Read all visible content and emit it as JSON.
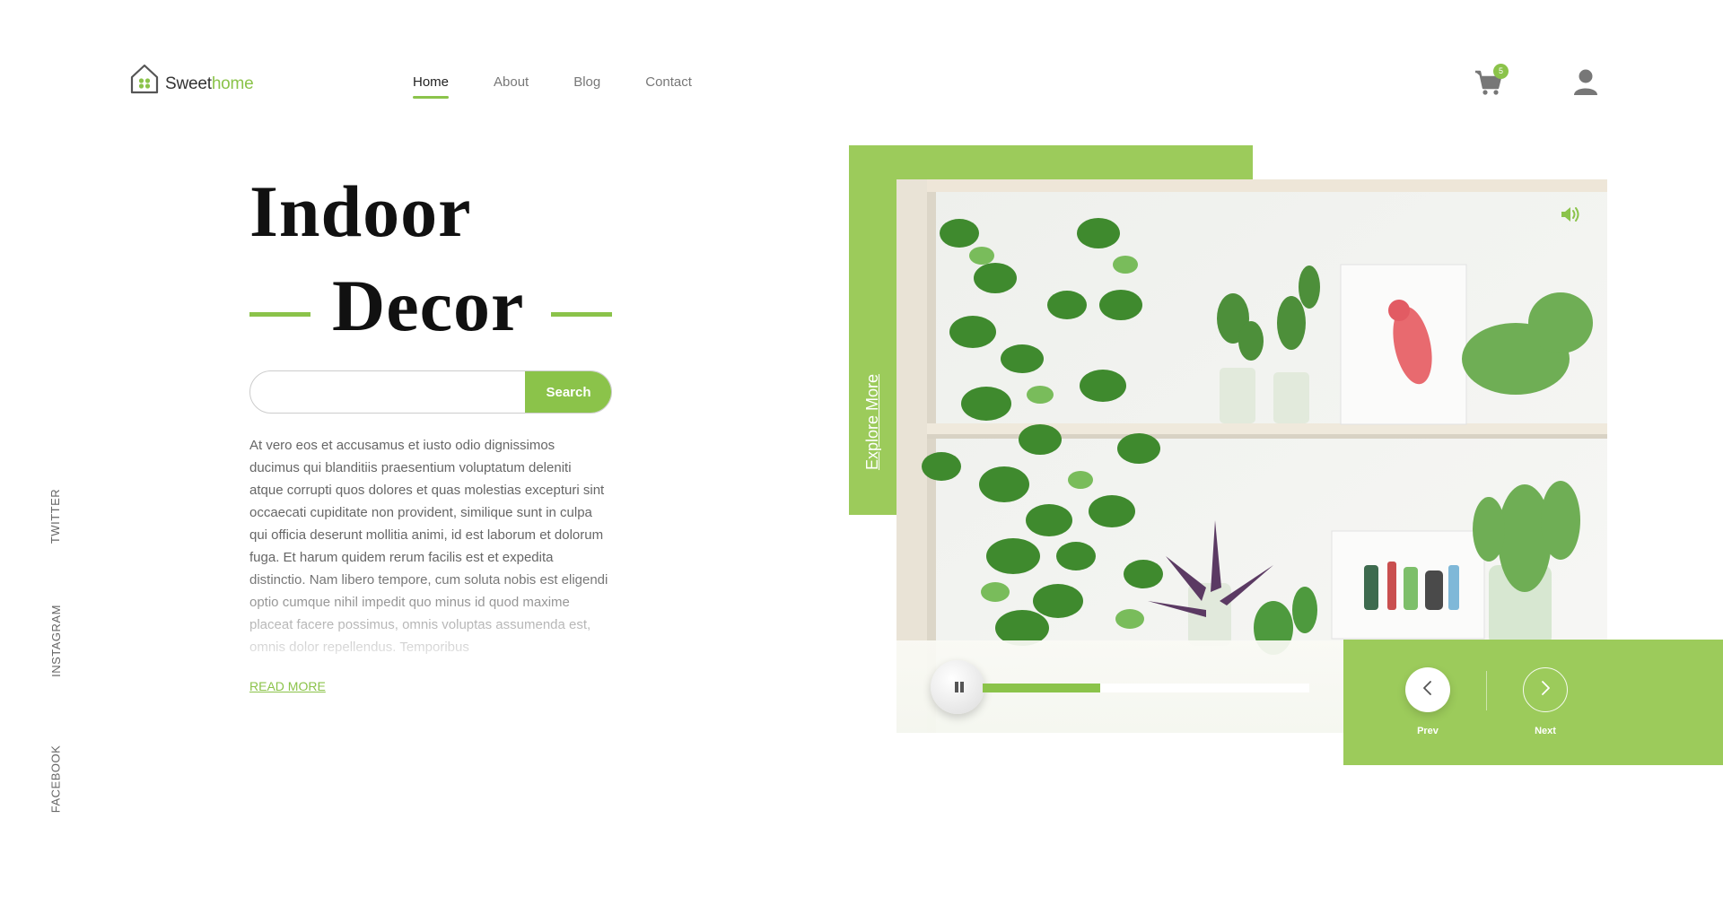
{
  "brand": {
    "name_part1": "Sweet",
    "name_part2": "home",
    "icon": "house-leaf-icon"
  },
  "nav": {
    "items": [
      {
        "label": "Home",
        "active": true
      },
      {
        "label": "About",
        "active": false
      },
      {
        "label": "Blog",
        "active": false
      },
      {
        "label": "Contact",
        "active": false
      }
    ]
  },
  "cart": {
    "count": "5",
    "icon": "cart-icon"
  },
  "user": {
    "icon": "user-icon"
  },
  "social": [
    "TWITTER",
    "INSTAGRAM",
    "FACEBOOK"
  ],
  "hero": {
    "title_line1": "Indoor",
    "title_line2": "Decor",
    "search_placeholder": "",
    "search_button": "Search",
    "paragraph": "At vero eos et accusamus et iusto odio dignissimos ducimus qui blanditiis praesentium voluptatum deleniti atque corrupti quos dolores et quas molestias excepturi sint occaecati cupiditate non provident, similique sunt in culpa qui officia deserunt mollitia animi, id est laborum et dolorum fuga. Et harum quidem rerum facilis est et expedita distinctio. Nam libero tempore, cum soluta nobis est eligendi optio cumque nihil impedit quo minus id quod maxime placeat facere possimus, omnis voluptas assumenda est, omnis dolor repellendus. Temporibus",
    "read_more": "READ MORE"
  },
  "showcase": {
    "explore_label": "Explore More",
    "progress_fraction": 0.36,
    "prev_label": "Prev",
    "next_label": "Next"
  },
  "colors": {
    "accent": "#8bc34a",
    "panel": "#9ccb5b"
  }
}
